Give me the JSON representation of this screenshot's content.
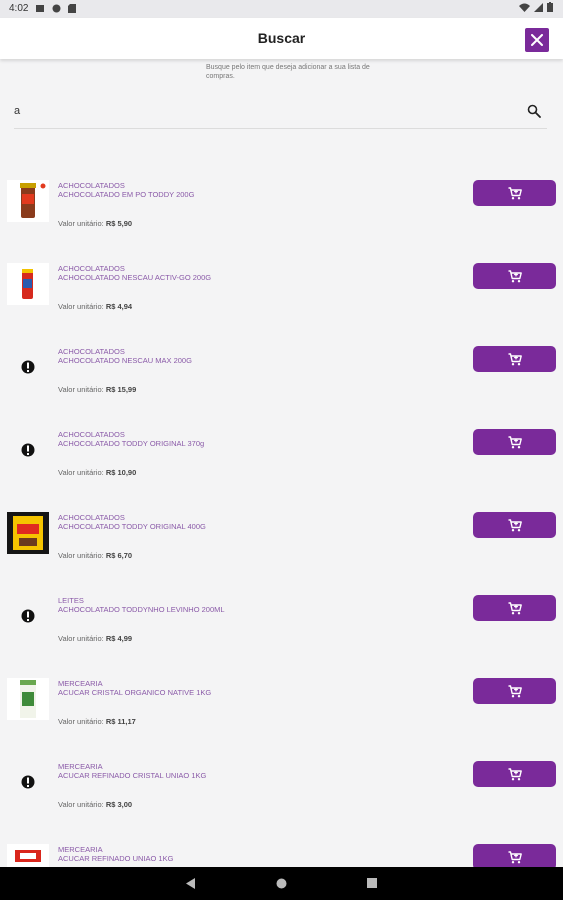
{
  "status_bar": {
    "time": "4:02"
  },
  "header": {
    "title": "Buscar"
  },
  "hint": "Busque pelo item que deseja adicionar a sua lista de compras.",
  "search": {
    "value": "a"
  },
  "price_label": "Valor unitário:",
  "items": [
    {
      "category": "ACHOCOLATADOS",
      "name": "ACHOCOLATADO EM PO TODDY 200G",
      "price": "R$ 5,90",
      "thumb": "toddy"
    },
    {
      "category": "ACHOCOLATADOS",
      "name": "ACHOCOLATADO NESCAU ACTIV-GO 200G",
      "price": "R$ 4,94",
      "thumb": "nescau"
    },
    {
      "category": "ACHOCOLATADOS",
      "name": "ACHOCOLATADO NESCAU MAX 200G",
      "price": "R$ 15,99",
      "thumb": "none"
    },
    {
      "category": "ACHOCOLATADOS",
      "name": "ACHOCOLATADO TODDY ORIGINAL 370g",
      "price": "R$ 10,90",
      "thumb": "none"
    },
    {
      "category": "ACHOCOLATADOS",
      "name": "ACHOCOLATADO TODDY ORIGINAL 400G",
      "price": "R$ 6,70",
      "thumb": "toddy-box"
    },
    {
      "category": "LEITES",
      "name": "ACHOCOLATADO TODDYNHO LEVINHO 200ML",
      "price": "R$ 4,99",
      "thumb": "none"
    },
    {
      "category": "MERCEARIA",
      "name": "ACUCAR CRISTAL ORGANICO NATIVE 1KG",
      "price": "R$ 11,17",
      "thumb": "native"
    },
    {
      "category": "MERCEARIA",
      "name": "ACUCAR REFINADO CRISTAL UNIAO 1KG",
      "price": "R$ 3,00",
      "thumb": "none"
    },
    {
      "category": "MERCEARIA",
      "name": "ACUCAR REFINADO UNIAO 1KG",
      "price": "",
      "thumb": "uniao"
    }
  ],
  "icons": {
    "close": "close-icon",
    "search": "search-icon",
    "cart": "add-to-cart-icon",
    "no_image": "alert-circle-icon"
  },
  "colors": {
    "accent": "#7a2a9a",
    "text_accent": "#8a5aa8",
    "background": "#f4f4f5"
  }
}
